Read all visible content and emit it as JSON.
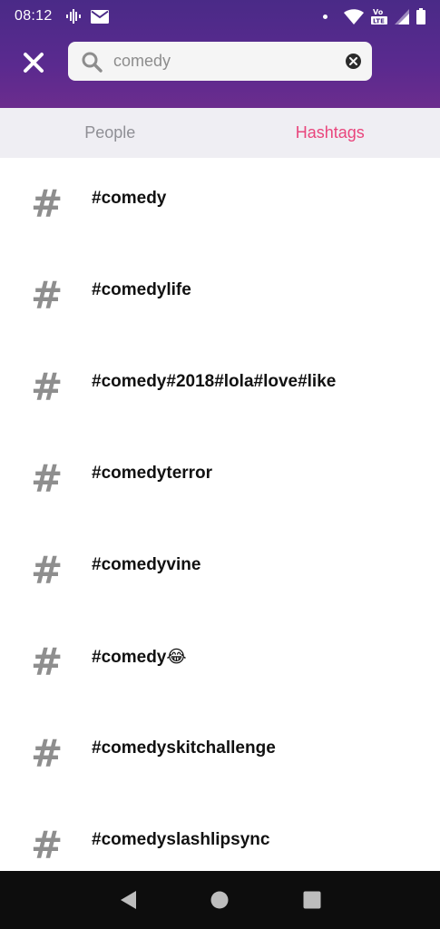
{
  "status_bar": {
    "time": "08:12"
  },
  "search": {
    "value": "comedy",
    "placeholder": "Search"
  },
  "tabs": [
    {
      "label": "People",
      "active": false
    },
    {
      "label": "Hashtags",
      "active": true
    }
  ],
  "hashtags": [
    {
      "symbol": "#",
      "label": "#comedy"
    },
    {
      "symbol": "#",
      "label": "#comedylife"
    },
    {
      "symbol": "#",
      "label": "#comedy#2018#lola#love#like"
    },
    {
      "symbol": "#",
      "label": "#comedyterror"
    },
    {
      "symbol": "#",
      "label": "#comedyvine"
    },
    {
      "symbol": "#",
      "label": "#comedy😂"
    },
    {
      "symbol": "#",
      "label": "#comedyskitchallenge"
    },
    {
      "symbol": "#",
      "label": "#comedyslashlipsync"
    }
  ],
  "colors": {
    "header_gradient_start": "#4a2a87",
    "header_gradient_end": "#6b2c8d",
    "active_tab": "#e9457c",
    "inactive_tab": "#8f8f95",
    "hash_icon": "#8e8e8e"
  },
  "icons": {
    "close": "close-icon",
    "search": "search-icon",
    "clear": "clear-icon",
    "hashtag": "hashtag-icon",
    "nav_back": "back-icon",
    "nav_home": "home-icon",
    "nav_recents": "recents-icon"
  }
}
